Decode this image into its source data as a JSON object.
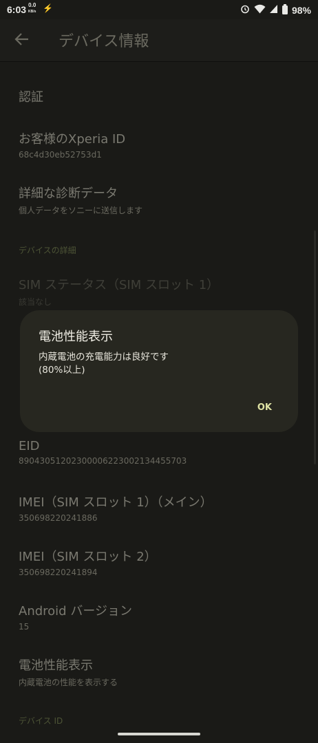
{
  "status_bar": {
    "time": "6:03",
    "data_speed_value": "0.0",
    "data_speed_unit": "KB/s",
    "battery": "98%"
  },
  "app_bar": {
    "title": "デバイス情報"
  },
  "items": {
    "auth": {
      "title": "認証"
    },
    "xperia_id": {
      "title": "お客様のXperia ID",
      "sub": "68c4d30eb52753d1"
    },
    "diagnostics": {
      "title": "詳細な診断データ",
      "sub": "個人データをソニーに送信します"
    },
    "section_device_details": "デバイスの詳細",
    "sim_status": {
      "title": "SIM ステータス（SIM スロット 1）",
      "sub": "該当なし"
    },
    "eid": {
      "title": "EID",
      "sub": "89043051202300006223002134455703"
    },
    "imei1": {
      "title": "IMEI（SIM スロット 1）（メイン）",
      "sub": "350698220241886"
    },
    "imei2": {
      "title": "IMEI（SIM スロット 2）",
      "sub": "350698220241894"
    },
    "android": {
      "title": "Android バージョン",
      "sub": "15"
    },
    "battery_perf": {
      "title": "電池性能表示",
      "sub": "内蔵電池の性能を表示する"
    },
    "section_device_id": "デバイス ID"
  },
  "dialog": {
    "title": "電池性能表示",
    "message_line1": "内蔵電池の充電能力は良好です",
    "message_line2": "(80%以上)",
    "ok_label": "OK"
  },
  "colors": {
    "background": "#1a1a17",
    "dialog_bg": "#272720",
    "accent": "#dfe3a4"
  }
}
